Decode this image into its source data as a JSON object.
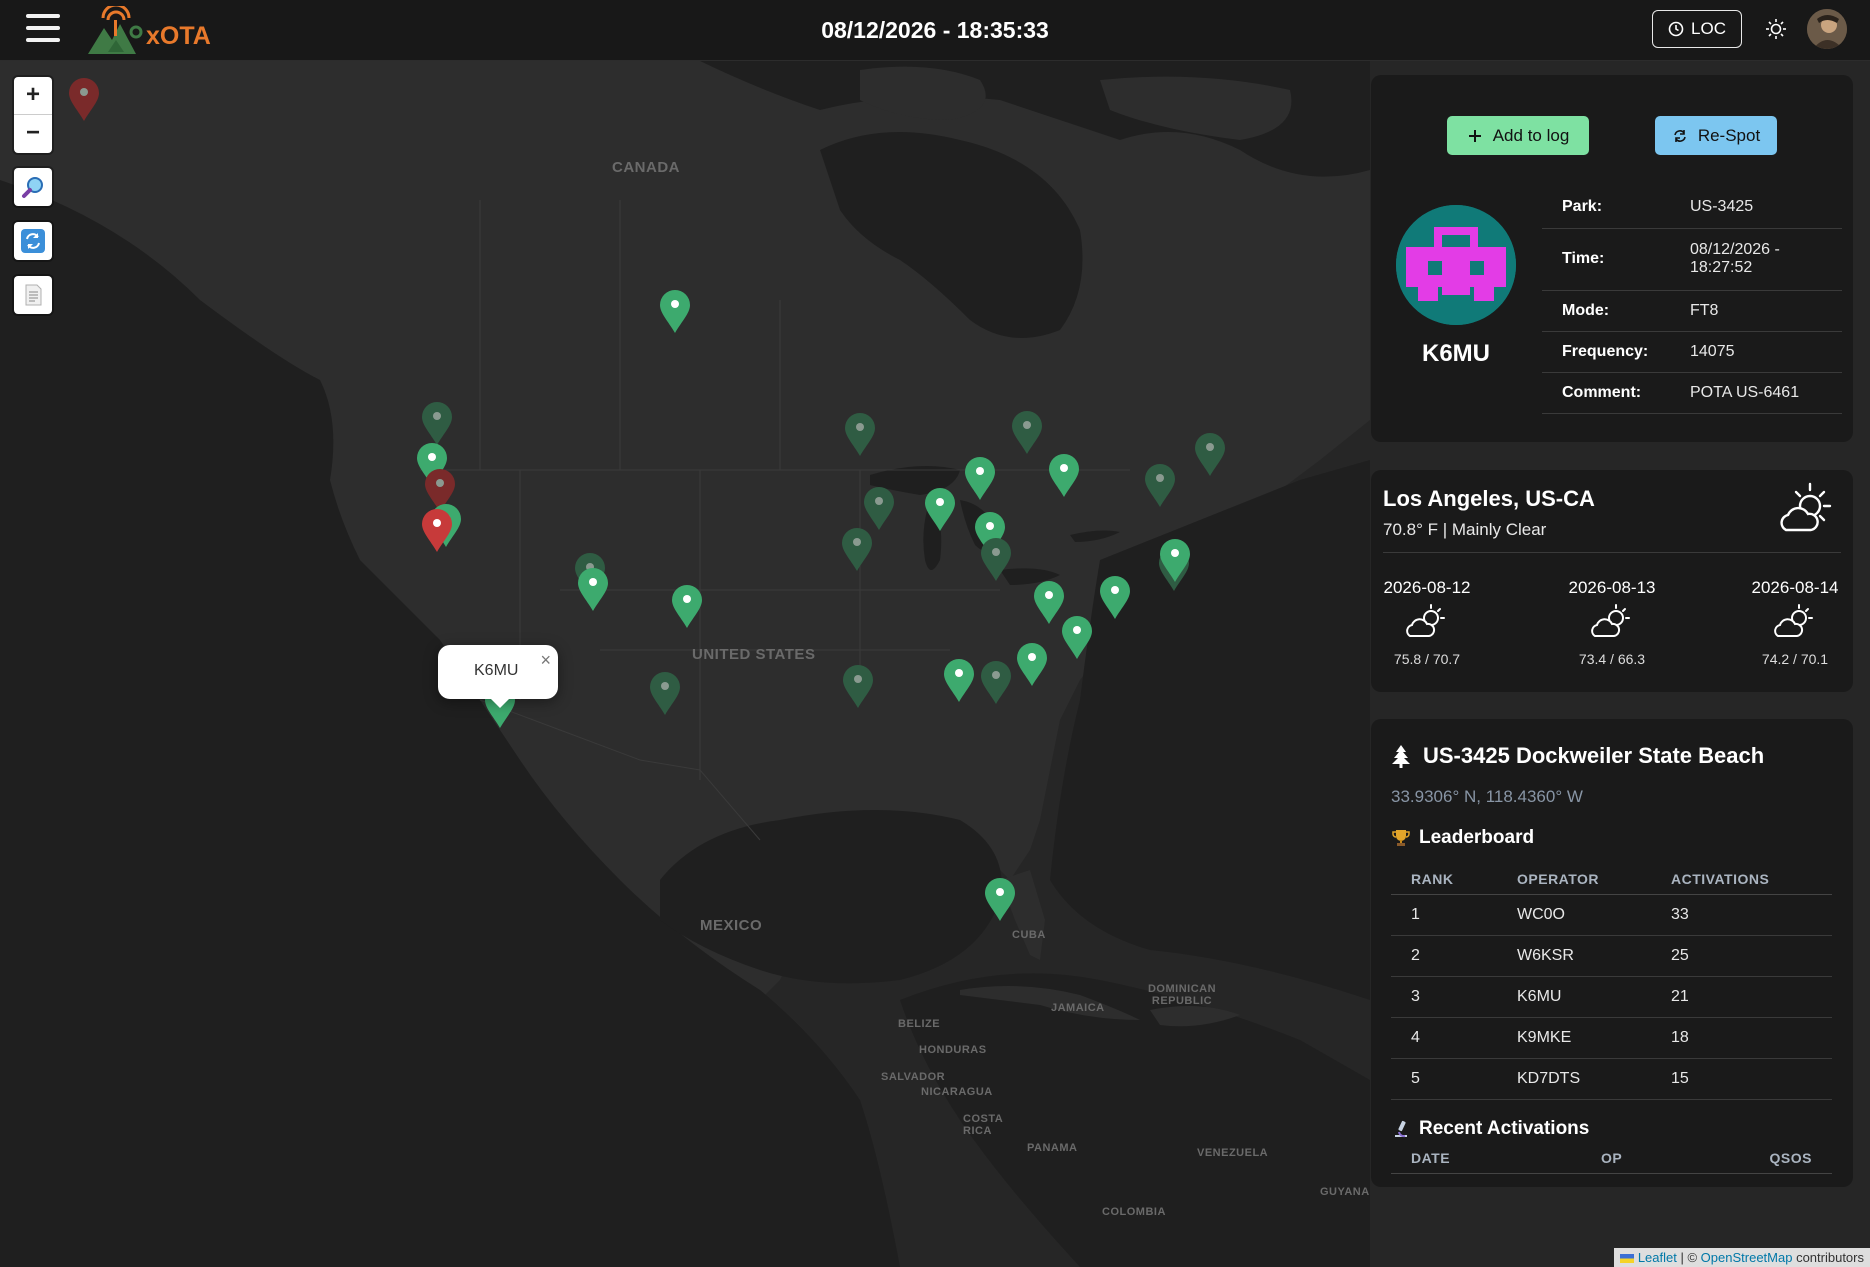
{
  "header": {
    "brand": "xOTA",
    "clock": "08/12/2026 - 18:35:33",
    "loc_label": "LOC"
  },
  "map": {
    "labels": {
      "canada": "CANADA",
      "united_states": "UNITED STATES",
      "mexico": "MEXICO",
      "cuba": "CUBA",
      "jamaica": "JAMAICA",
      "dominican": "DOMINICAN REPUBLIC",
      "belize": "BELIZE",
      "honduras": "HONDURAS",
      "salvador": "SALVADOR",
      "nicaragua": "NICARAGUA",
      "costa_rica": "COSTA RICA",
      "panama": "PANAMA",
      "venezuela": "VENEZUELA",
      "guyana": "GUYANA",
      "colombia": "COLOMBIA"
    },
    "popup_callsign": "K6MU",
    "attribution": {
      "leaflet": "Leaflet",
      "separator": " | © ",
      "osm": "OpenStreetMap",
      "suffix": " contributors"
    },
    "colors": {
      "active": "#3daa6e",
      "dim": "#2f5c43",
      "alert": "#c73a3a",
      "alert_dim": "#7a2a2a"
    }
  },
  "spot": {
    "add_to_log": "Add to log",
    "respot": "Re-Spot",
    "callsign": "K6MU",
    "rows": [
      {
        "key": "Park:",
        "value": "US-3425"
      },
      {
        "key": "Time:",
        "value": "08/12/2026 - 18:27:52"
      },
      {
        "key": "Mode:",
        "value": "FT8"
      },
      {
        "key": "Frequency:",
        "value": "14075"
      },
      {
        "key": "Comment:",
        "value": "POTA US-6461"
      }
    ]
  },
  "weather": {
    "city": "Los Angeles, US-CA",
    "current": "70.8° F | Mainly Clear",
    "days": [
      {
        "date": "2026-08-12",
        "temps": "75.8 / 70.7"
      },
      {
        "date": "2026-08-13",
        "temps": "73.4 / 66.3"
      },
      {
        "date": "2026-08-14",
        "temps": "74.2 / 70.1"
      }
    ]
  },
  "park": {
    "title": "US-3425 Dockweiler State Beach",
    "coords": "33.9306° N, 118.4360° W",
    "leaderboard_title": "Leaderboard",
    "columns": [
      "RANK",
      "OPERATOR",
      "ACTIVATIONS"
    ],
    "rows": [
      {
        "rank": "1",
        "op": "WC0O",
        "count": "33"
      },
      {
        "rank": "2",
        "op": "W6KSR",
        "count": "25"
      },
      {
        "rank": "3",
        "op": "K6MU",
        "count": "21"
      },
      {
        "rank": "4",
        "op": "K9MKE",
        "count": "18"
      },
      {
        "rank": "5",
        "op": "KD7DTS",
        "count": "15"
      }
    ],
    "recent_title": "Recent Activations",
    "recent_columns": [
      "DATE",
      "OP",
      "QSOS"
    ]
  }
}
